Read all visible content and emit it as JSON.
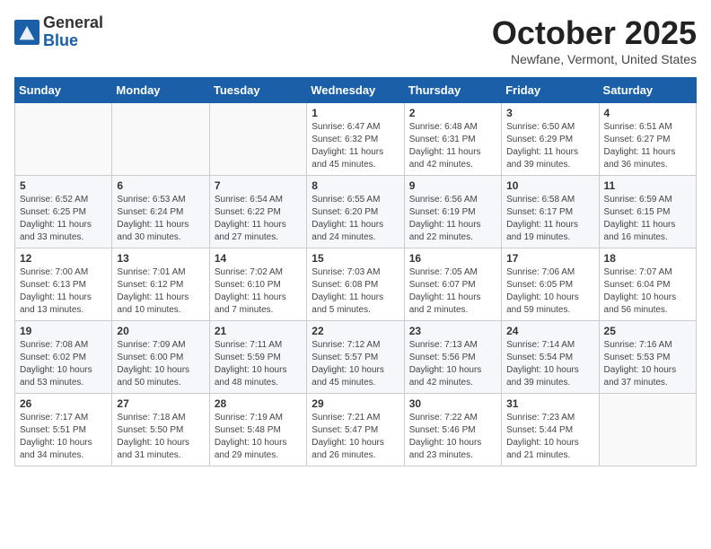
{
  "header": {
    "logo_general": "General",
    "logo_blue": "Blue",
    "month_title": "October 2025",
    "location": "Newfane, Vermont, United States"
  },
  "weekdays": [
    "Sunday",
    "Monday",
    "Tuesday",
    "Wednesday",
    "Thursday",
    "Friday",
    "Saturday"
  ],
  "weeks": [
    [
      {
        "day": "",
        "info": ""
      },
      {
        "day": "",
        "info": ""
      },
      {
        "day": "",
        "info": ""
      },
      {
        "day": "1",
        "info": "Sunrise: 6:47 AM\nSunset: 6:32 PM\nDaylight: 11 hours and 45 minutes."
      },
      {
        "day": "2",
        "info": "Sunrise: 6:48 AM\nSunset: 6:31 PM\nDaylight: 11 hours and 42 minutes."
      },
      {
        "day": "3",
        "info": "Sunrise: 6:50 AM\nSunset: 6:29 PM\nDaylight: 11 hours and 39 minutes."
      },
      {
        "day": "4",
        "info": "Sunrise: 6:51 AM\nSunset: 6:27 PM\nDaylight: 11 hours and 36 minutes."
      }
    ],
    [
      {
        "day": "5",
        "info": "Sunrise: 6:52 AM\nSunset: 6:25 PM\nDaylight: 11 hours and 33 minutes."
      },
      {
        "day": "6",
        "info": "Sunrise: 6:53 AM\nSunset: 6:24 PM\nDaylight: 11 hours and 30 minutes."
      },
      {
        "day": "7",
        "info": "Sunrise: 6:54 AM\nSunset: 6:22 PM\nDaylight: 11 hours and 27 minutes."
      },
      {
        "day": "8",
        "info": "Sunrise: 6:55 AM\nSunset: 6:20 PM\nDaylight: 11 hours and 24 minutes."
      },
      {
        "day": "9",
        "info": "Sunrise: 6:56 AM\nSunset: 6:19 PM\nDaylight: 11 hours and 22 minutes."
      },
      {
        "day": "10",
        "info": "Sunrise: 6:58 AM\nSunset: 6:17 PM\nDaylight: 11 hours and 19 minutes."
      },
      {
        "day": "11",
        "info": "Sunrise: 6:59 AM\nSunset: 6:15 PM\nDaylight: 11 hours and 16 minutes."
      }
    ],
    [
      {
        "day": "12",
        "info": "Sunrise: 7:00 AM\nSunset: 6:13 PM\nDaylight: 11 hours and 13 minutes."
      },
      {
        "day": "13",
        "info": "Sunrise: 7:01 AM\nSunset: 6:12 PM\nDaylight: 11 hours and 10 minutes."
      },
      {
        "day": "14",
        "info": "Sunrise: 7:02 AM\nSunset: 6:10 PM\nDaylight: 11 hours and 7 minutes."
      },
      {
        "day": "15",
        "info": "Sunrise: 7:03 AM\nSunset: 6:08 PM\nDaylight: 11 hours and 5 minutes."
      },
      {
        "day": "16",
        "info": "Sunrise: 7:05 AM\nSunset: 6:07 PM\nDaylight: 11 hours and 2 minutes."
      },
      {
        "day": "17",
        "info": "Sunrise: 7:06 AM\nSunset: 6:05 PM\nDaylight: 10 hours and 59 minutes."
      },
      {
        "day": "18",
        "info": "Sunrise: 7:07 AM\nSunset: 6:04 PM\nDaylight: 10 hours and 56 minutes."
      }
    ],
    [
      {
        "day": "19",
        "info": "Sunrise: 7:08 AM\nSunset: 6:02 PM\nDaylight: 10 hours and 53 minutes."
      },
      {
        "day": "20",
        "info": "Sunrise: 7:09 AM\nSunset: 6:00 PM\nDaylight: 10 hours and 50 minutes."
      },
      {
        "day": "21",
        "info": "Sunrise: 7:11 AM\nSunset: 5:59 PM\nDaylight: 10 hours and 48 minutes."
      },
      {
        "day": "22",
        "info": "Sunrise: 7:12 AM\nSunset: 5:57 PM\nDaylight: 10 hours and 45 minutes."
      },
      {
        "day": "23",
        "info": "Sunrise: 7:13 AM\nSunset: 5:56 PM\nDaylight: 10 hours and 42 minutes."
      },
      {
        "day": "24",
        "info": "Sunrise: 7:14 AM\nSunset: 5:54 PM\nDaylight: 10 hours and 39 minutes."
      },
      {
        "day": "25",
        "info": "Sunrise: 7:16 AM\nSunset: 5:53 PM\nDaylight: 10 hours and 37 minutes."
      }
    ],
    [
      {
        "day": "26",
        "info": "Sunrise: 7:17 AM\nSunset: 5:51 PM\nDaylight: 10 hours and 34 minutes."
      },
      {
        "day": "27",
        "info": "Sunrise: 7:18 AM\nSunset: 5:50 PM\nDaylight: 10 hours and 31 minutes."
      },
      {
        "day": "28",
        "info": "Sunrise: 7:19 AM\nSunset: 5:48 PM\nDaylight: 10 hours and 29 minutes."
      },
      {
        "day": "29",
        "info": "Sunrise: 7:21 AM\nSunset: 5:47 PM\nDaylight: 10 hours and 26 minutes."
      },
      {
        "day": "30",
        "info": "Sunrise: 7:22 AM\nSunset: 5:46 PM\nDaylight: 10 hours and 23 minutes."
      },
      {
        "day": "31",
        "info": "Sunrise: 7:23 AM\nSunset: 5:44 PM\nDaylight: 10 hours and 21 minutes."
      },
      {
        "day": "",
        "info": ""
      }
    ]
  ]
}
